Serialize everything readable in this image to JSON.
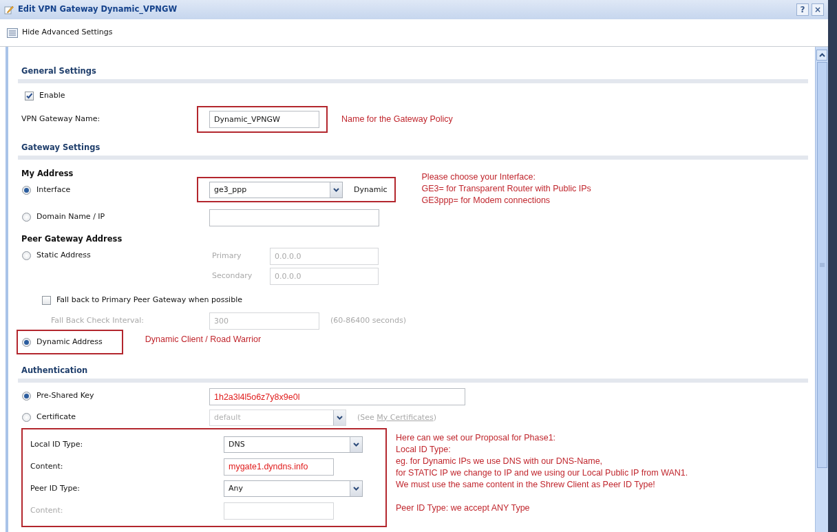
{
  "window": {
    "title": "Edit VPN Gateway Dynamic_VPNGW",
    "buttons": [
      "?",
      "×"
    ]
  },
  "toolbar": {
    "label": "Hide Advanced Settings"
  },
  "sections": [
    {
      "title": "General Settings",
      "rows": [
        {
          "kind": "checkbox",
          "label": "Enable",
          "checked": true
        },
        {
          "kind": "field",
          "label": "VPN Gateway Name:",
          "value": "Dynamic_VPNGW",
          "framed": true,
          "note": "Name for the Gateway Policy"
        }
      ]
    },
    {
      "title": "Gateway Settings",
      "rows": [
        {
          "kind": "subheading",
          "label": "My Address"
        },
        {
          "kind": "radio",
          "label": "Interface",
          "selected": true,
          "control": {
            "kind": "select",
            "value": "ge3_ppp",
            "suffix": "Dynamic"
          },
          "framed": true,
          "note": "Please choose your Interface:\nGE3= for Transparent  Router with Public IPs\nGE3ppp= for Modem connections"
        },
        {
          "kind": "radio",
          "label": "Domain Name / IP",
          "selected": false,
          "control": {
            "kind": "field"
          }
        },
        {
          "kind": "subheading",
          "label": "Peer Gateway Address"
        },
        {
          "kind": "radio",
          "label": "Static Address",
          "selected": false,
          "subfields": [
            {
              "label": "Primary",
              "value": "0.0.0.0",
              "disabled": true
            },
            {
              "label": "Secondary",
              "value": "0.0.0.0",
              "disabled": true
            }
          ],
          "children": [
            {
              "kind": "checkbox",
              "label": "Fall back to Primary Peer Gateway when possible",
              "checked": false
            },
            {
              "kind": "field",
              "label": "Fall Back Check Interval:",
              "value": "300",
              "disabled": true,
              "hint": "(60-86400 seconds)"
            }
          ]
        },
        {
          "kind": "radio",
          "label": "Dynamic Address",
          "selected": true,
          "framed": true,
          "note": "Dynamic Client / Road Warrior"
        }
      ]
    },
    {
      "title": "Authentication",
      "rows": [
        {
          "kind": "radio",
          "label": "Pre-Shared Key",
          "selected": true,
          "control": {
            "kind": "field",
            "value": "1h2a3l4l5o6z7y8x9e0l",
            "highlighted": true
          }
        },
        {
          "kind": "radio",
          "label": "Certificate",
          "selected": false,
          "control": {
            "kind": "select",
            "value": "default",
            "disabled": true,
            "hint": "(See ",
            "link": "My Certificates",
            "hint_end": ")"
          }
        },
        {
          "kind": "group",
          "framed": true,
          "note": "Here can we set our Proposal for Phase1:\nLocal ID Type:\neg. for Dynamic IPs we use DNS with our DNS-Name,\nfor STATIC IP we change to IP and we using our Local Public IP from WAN1.\nWe must use the same content in the Shrew Client as Peer ID Type!\n\nPeer ID Type: we accept ANY Type",
          "rows": [
            {
              "kind": "select",
              "label": "Local ID Type:",
              "value": "DNS"
            },
            {
              "kind": "field",
              "label": "Content:",
              "value": "mygate1.dyndns.info",
              "highlighted": true
            },
            {
              "kind": "select",
              "label": "Peer ID Type:",
              "value": "Any"
            },
            {
              "kind": "field",
              "label": "Content:",
              "disabled": true
            }
          ]
        }
      ]
    }
  ]
}
